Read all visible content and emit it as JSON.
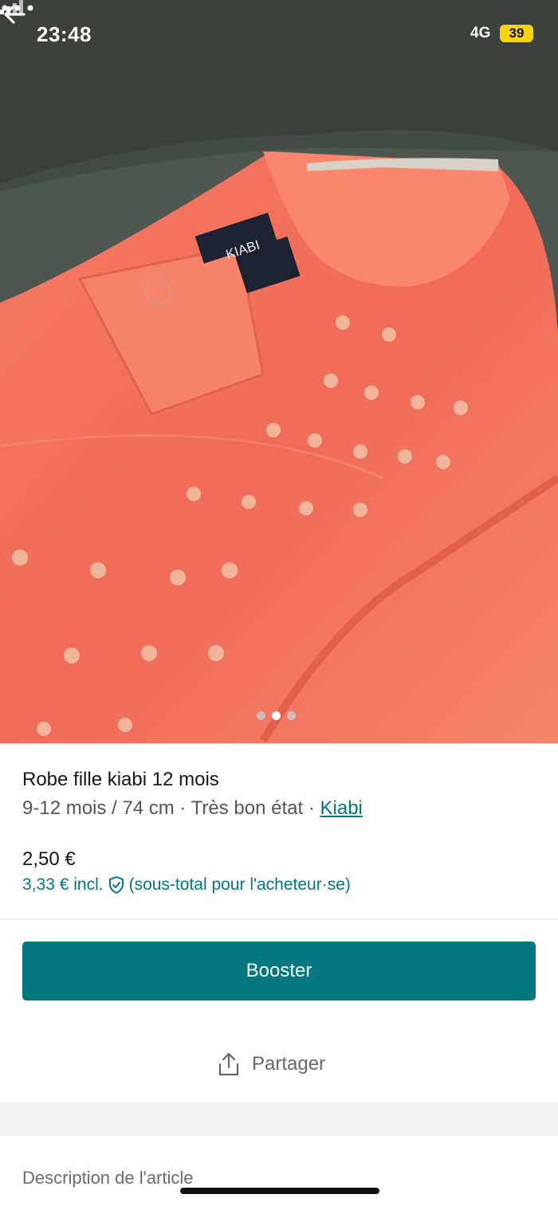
{
  "status_bar": {
    "time": "23:48",
    "network": "4G",
    "battery": "39"
  },
  "icons": {
    "back": "arrow-left-icon",
    "more": "more-horizontal-icon",
    "shield": "shield-check-icon",
    "share": "share-upload-icon"
  },
  "gallery": {
    "image_count": 3,
    "active_index": 1,
    "label_brand": "KIABI"
  },
  "item": {
    "title": "Robe fille kiabi 12 mois",
    "size": "9-12 mois / 74 cm",
    "sep1": " · ",
    "condition": "Très bon état",
    "sep2": " · ",
    "brand": "Kiabi",
    "price": "2,50 €",
    "price_incl": "3,33 € incl.",
    "price_incl_note": "(sous-total pour l'acheteur·se)"
  },
  "actions": {
    "boost_label": "Booster",
    "share_label": "Partager"
  },
  "description": {
    "label": "Description de l'article"
  },
  "colors": {
    "accent": "#007782",
    "boost_bg": "#037880",
    "fabric": "#f0735e"
  }
}
